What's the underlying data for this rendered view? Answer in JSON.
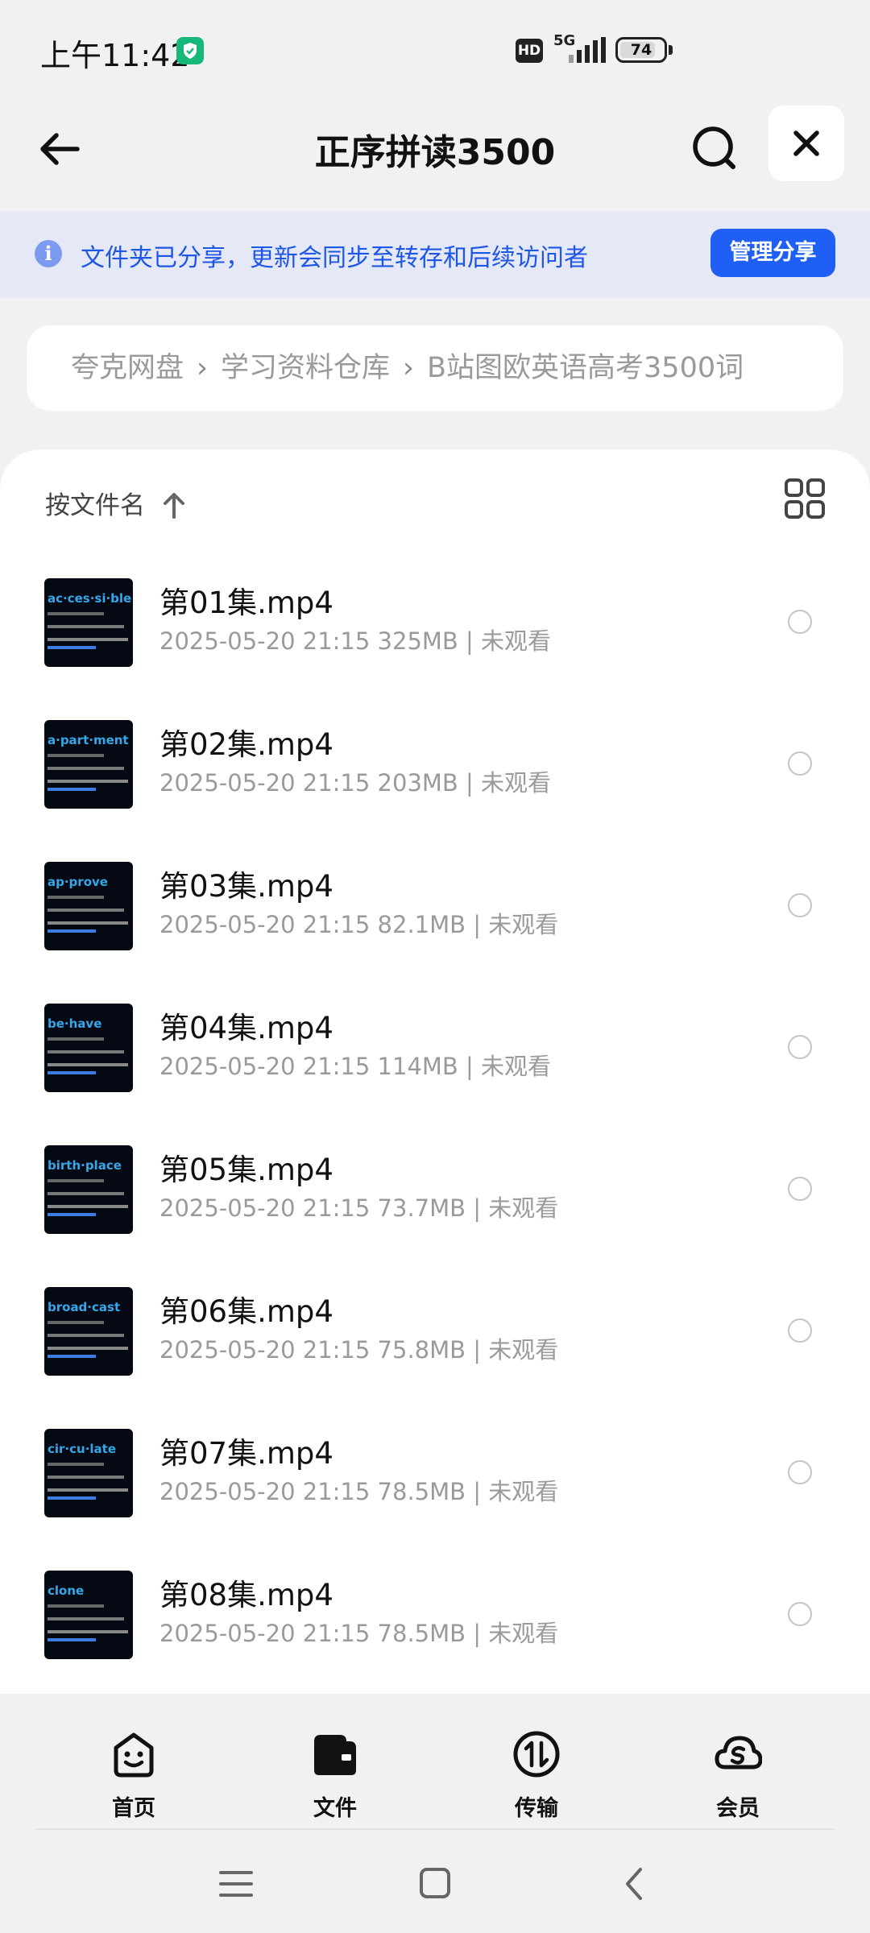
{
  "status_bar": {
    "time": "上午11:42",
    "hd_badge": "HD",
    "network": "5G",
    "battery": "74",
    "battery_level": 0.74
  },
  "header": {
    "title": "正序拼读3500"
  },
  "share_banner": {
    "text": "文件夹已分享，更新会同步至转存和后续访问者",
    "manage_button": "管理分享"
  },
  "breadcrumb": [
    "夸克网盘",
    "学习资料仓库",
    "B站图欧英语高考3500词"
  ],
  "sort": {
    "label": "按文件名"
  },
  "files": [
    {
      "name": "第01集.mp4",
      "date": "2025-05-20 21:15",
      "size": "325MB",
      "status": "未观看",
      "thumb_word": "ac·ces·si·ble"
    },
    {
      "name": "第02集.mp4",
      "date": "2025-05-20 21:15",
      "size": "203MB",
      "status": "未观看",
      "thumb_word": "a·part·ment"
    },
    {
      "name": "第03集.mp4",
      "date": "2025-05-20 21:15",
      "size": "82.1MB",
      "status": "未观看",
      "thumb_word": "ap·prove"
    },
    {
      "name": "第04集.mp4",
      "date": "2025-05-20 21:15",
      "size": "114MB",
      "status": "未观看",
      "thumb_word": "be·have"
    },
    {
      "name": "第05集.mp4",
      "date": "2025-05-20 21:15",
      "size": "73.7MB",
      "status": "未观看",
      "thumb_word": "birth·place"
    },
    {
      "name": "第06集.mp4",
      "date": "2025-05-20 21:15",
      "size": "75.8MB",
      "status": "未观看",
      "thumb_word": "broad·cast"
    },
    {
      "name": "第07集.mp4",
      "date": "2025-05-20 21:15",
      "size": "78.5MB",
      "status": "未观看",
      "thumb_word": "cir·cu·late"
    },
    {
      "name": "第08集.mp4",
      "date": "2025-05-20 21:15",
      "size": "78.5MB",
      "status": "未观看",
      "thumb_word": "clone"
    }
  ],
  "bottom_nav": [
    {
      "label": "首页",
      "icon": "home-smiley-icon"
    },
    {
      "label": "文件",
      "icon": "folder-icon"
    },
    {
      "label": "传输",
      "icon": "transfer-icon"
    },
    {
      "label": "会员",
      "icon": "vip-cloud-icon"
    }
  ],
  "colors": {
    "accent": "#1f5ff5",
    "banner_bg": "#e5e8f6",
    "banner_text": "#1e56e6",
    "page_bg": "#f1f1f3"
  }
}
